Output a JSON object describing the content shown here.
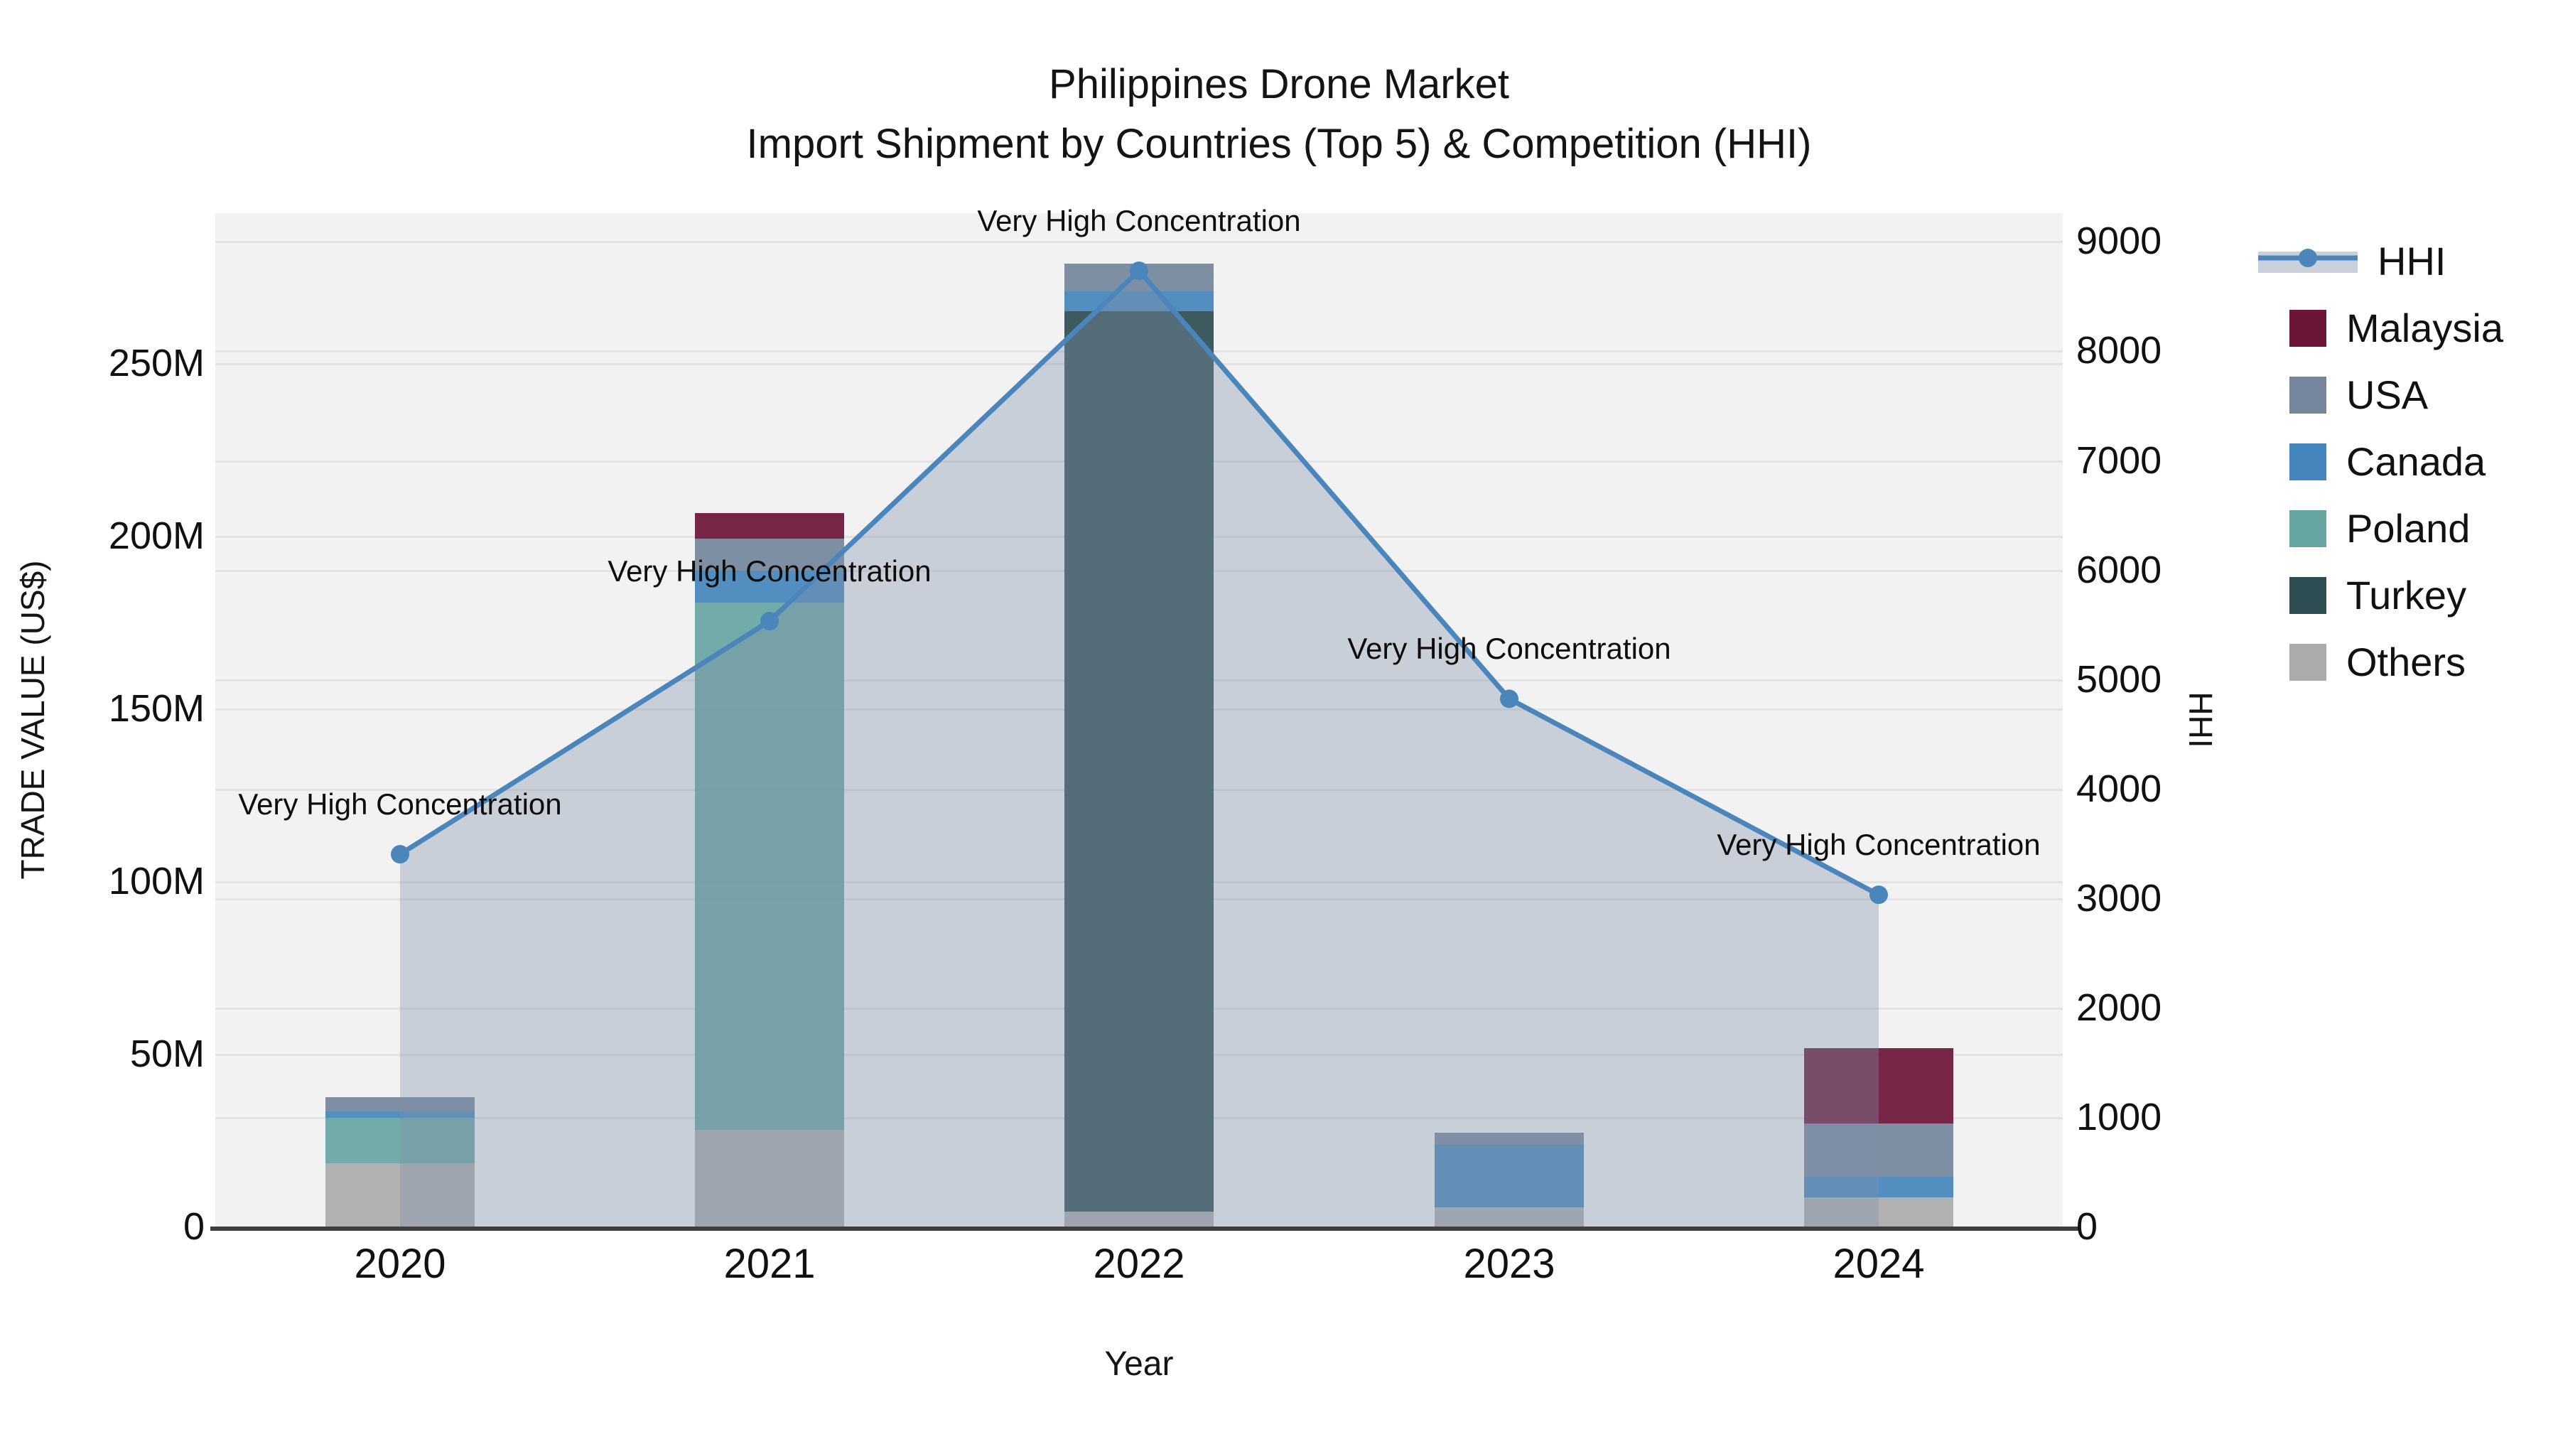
{
  "title": {
    "line1": "Philippines Drone Market",
    "line2": "Import Shipment by Countries (Top 5) & Competition (HHI)"
  },
  "axes": {
    "x": {
      "label": "Year",
      "ticks": [
        "2020",
        "2021",
        "2022",
        "2023",
        "2024"
      ]
    },
    "y_left": {
      "label": "TRADE VALUE (US$)",
      "ticks": [
        "0",
        "50M",
        "100M",
        "150M",
        "200M",
        "250M"
      ],
      "tick_values_musd": [
        0,
        50,
        100,
        150,
        200,
        250
      ],
      "range_musd": [
        0,
        293
      ]
    },
    "y_right": {
      "label": "HHI",
      "ticks": [
        "0",
        "1000",
        "2000",
        "3000",
        "4000",
        "5000",
        "6000",
        "7000",
        "8000",
        "9000"
      ],
      "tick_values": [
        0,
        1000,
        2000,
        3000,
        4000,
        5000,
        6000,
        7000,
        8000,
        9000
      ],
      "range": [
        0,
        9256
      ]
    }
  },
  "legend": {
    "items": [
      {
        "label": "HHI",
        "type": "line",
        "color": "#4a86bc",
        "band_color": "#c9d0da"
      },
      {
        "label": "Malaysia",
        "type": "square",
        "color": "#6d1537"
      },
      {
        "label": "USA",
        "type": "square",
        "color": "#74859c"
      },
      {
        "label": "Canada",
        "type": "square",
        "color": "#4585bd"
      },
      {
        "label": "Poland",
        "type": "square",
        "color": "#67a5a3"
      },
      {
        "label": "Turkey",
        "type": "square",
        "color": "#2e4d53"
      },
      {
        "label": "Others",
        "type": "square",
        "color": "#ababab"
      }
    ]
  },
  "chart_data": {
    "type": "combo: stacked bar (left axis, trade value US$M) + line with area fill (right axis, HHI)",
    "categories": [
      "2020",
      "2021",
      "2022",
      "2023",
      "2024"
    ],
    "bar_unit": "US$ millions",
    "bar_stack_order_bottom_to_top": [
      "Others",
      "Turkey",
      "Poland",
      "Canada",
      "USA",
      "Malaysia"
    ],
    "bar_series": [
      {
        "name": "Others",
        "color": "#ababab",
        "values": [
          18.3,
          28.0,
          4.4,
          5.6,
          8.4
        ]
      },
      {
        "name": "Turkey",
        "color": "#2e4d53",
        "values": [
          0,
          0,
          260.6,
          0,
          0
        ]
      },
      {
        "name": "Poland",
        "color": "#67a5a3",
        "values": [
          13.2,
          152.5,
          0,
          0,
          0
        ]
      },
      {
        "name": "Canada",
        "color": "#4585bd",
        "values": [
          1.9,
          9.4,
          5.6,
          18.1,
          6.0
        ]
      },
      {
        "name": "USA",
        "color": "#74859c",
        "values": [
          4.1,
          9.1,
          8.0,
          3.5,
          15.4
        ]
      },
      {
        "name": "Malaysia",
        "color": "#6d1537",
        "values": [
          0,
          7.4,
          0,
          0,
          21.8
        ]
      }
    ],
    "bar_totals_musd": [
      37.5,
      206.4,
      278.6,
      27.2,
      51.6
    ],
    "line_series": {
      "name": "HHI",
      "axis": "right",
      "color": "#4a86bc",
      "fill_color": "rgba(125,145,170,0.36)",
      "values": [
        3400,
        5530,
        8730,
        4820,
        3030
      ]
    },
    "annotations": [
      {
        "year": "2020",
        "text": "Very High Concentration"
      },
      {
        "year": "2021",
        "text": "Very High Concentration"
      },
      {
        "year": "2022",
        "text": "Very High Concentration"
      },
      {
        "year": "2023",
        "text": "Very High Concentration"
      },
      {
        "year": "2024",
        "text": "Very High Concentration"
      }
    ]
  }
}
